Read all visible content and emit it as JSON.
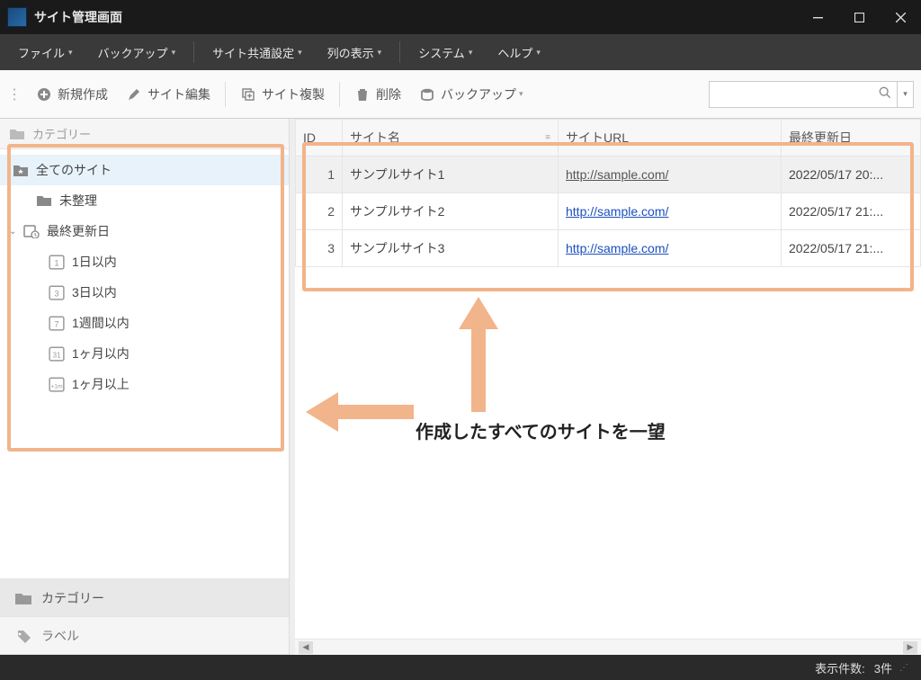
{
  "window": {
    "title": "サイト管理画面"
  },
  "menu": {
    "file": "ファイル",
    "backup": "バックアップ",
    "site_common": "サイト共通設定",
    "columns": "列の表示",
    "system": "システム",
    "help": "ヘルプ"
  },
  "toolbar": {
    "new": "新規作成",
    "edit": "サイト編集",
    "duplicate": "サイト複製",
    "delete": "削除",
    "backup": "バックアップ",
    "search_placeholder": ""
  },
  "sidebar": {
    "header": "カテゴリー",
    "all_sites": "全てのサイト",
    "unsorted": "未整理",
    "last_updated": "最終更新日",
    "within_1d": "1日以内",
    "within_3d": "3日以内",
    "within_1w": "1週間以内",
    "within_1m": "1ヶ月以内",
    "over_1m": "1ヶ月以上",
    "tab_category": "カテゴリー",
    "tab_label": "ラベル"
  },
  "table": {
    "cols": {
      "id": "ID",
      "name": "サイト名",
      "url": "サイトURL",
      "updated": "最終更新日"
    },
    "rows": [
      {
        "id": "1",
        "name": "サンプルサイト1",
        "url": "http://sample.com/",
        "updated": "2022/05/17 20:..."
      },
      {
        "id": "2",
        "name": "サンプルサイト2",
        "url": "http://sample.com/",
        "updated": "2022/05/17 21:..."
      },
      {
        "id": "3",
        "name": "サンプルサイト3",
        "url": "http://sample.com/",
        "updated": "2022/05/17 21:..."
      }
    ]
  },
  "annotation": {
    "callout": "作成したすべてのサイトを一望"
  },
  "status": {
    "count_label": "表示件数:",
    "count_value": "3件"
  }
}
